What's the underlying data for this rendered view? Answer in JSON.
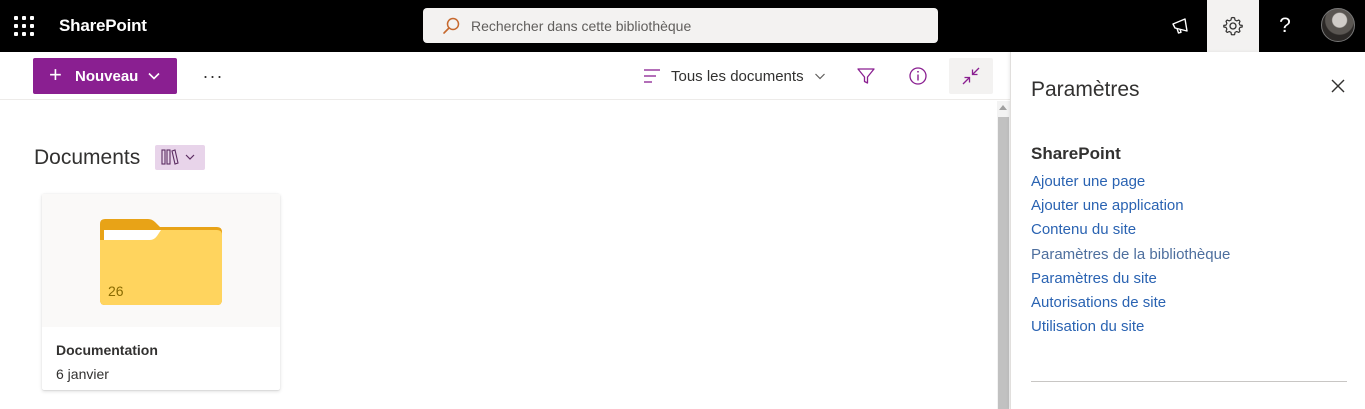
{
  "suitebar": {
    "brand": "SharePoint",
    "search_placeholder": "Rechercher dans cette bibliothèque",
    "help_label": "?"
  },
  "commandbar": {
    "new_label": "Nouveau",
    "more_label": "···",
    "view_label": "Tous les documents"
  },
  "library": {
    "title": "Documents",
    "items": [
      {
        "name": "Documentation",
        "date": "6 janvier",
        "count": "26"
      }
    ]
  },
  "settings_pane": {
    "title": "Paramètres",
    "section": "SharePoint",
    "links": [
      "Ajouter une page",
      "Ajouter une application",
      "Contenu du site",
      "Paramètres de la bibliothèque",
      "Paramètres du site",
      "Autorisations de site",
      "Utilisation du site"
    ],
    "highlighted_link": "Paramètres de la bibliothèque"
  },
  "colors": {
    "accent": "#8a1f91",
    "link": "#2a63b2",
    "suitebar": "#000000",
    "folder": "#ffc83d"
  },
  "icons": {
    "app_launcher": "waffle-icon",
    "search": "search-icon",
    "feedback": "megaphone-icon",
    "settings": "gear-icon",
    "help": "help-icon",
    "view": "view-list-icon",
    "filter": "filter-icon",
    "info": "info-icon",
    "collapse": "collapse-icon",
    "library_switch": "library-books-icon",
    "close": "close-icon"
  }
}
